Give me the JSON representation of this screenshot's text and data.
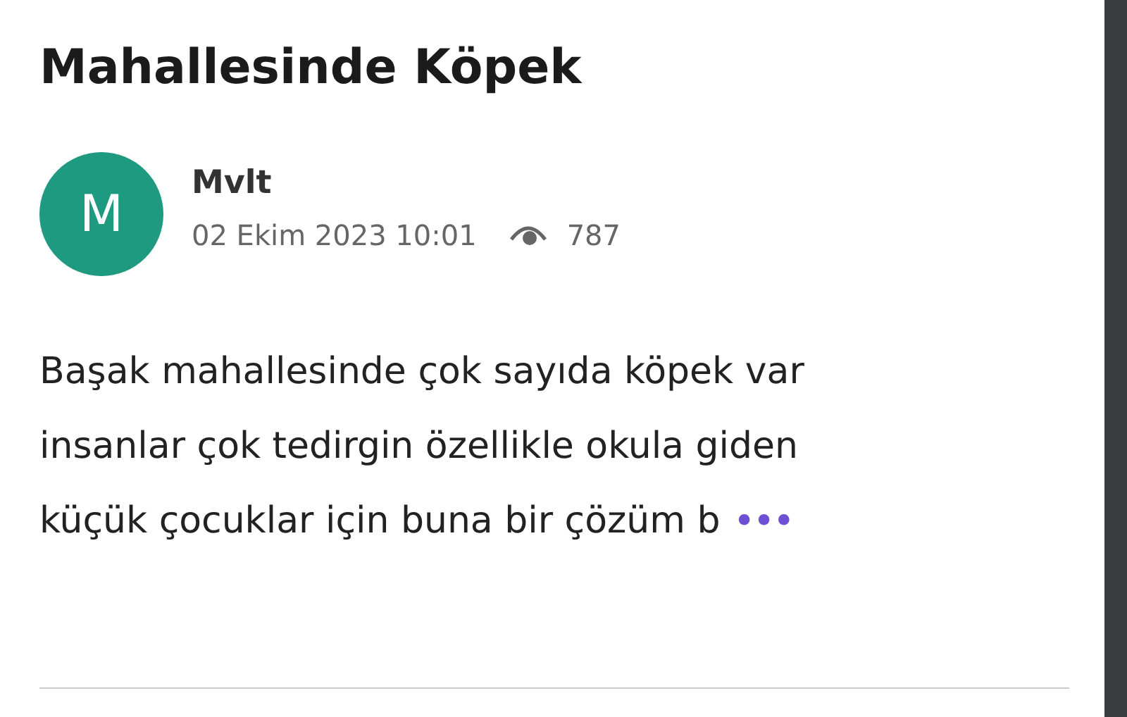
{
  "article": {
    "title_lines": [
      "Mahallesinde Köpek"
    ],
    "author": {
      "initial": "M",
      "name": "Mvlt",
      "date": "02 Ekim 2023 10:01",
      "views": "787"
    },
    "body_lines": [
      "Başak mahallesinde çok sayıda köpek var",
      "insanlar çok tedirgin özellikle okula giden",
      "küçük çocuklar için buna bir çözüm b"
    ],
    "more": "•••"
  }
}
